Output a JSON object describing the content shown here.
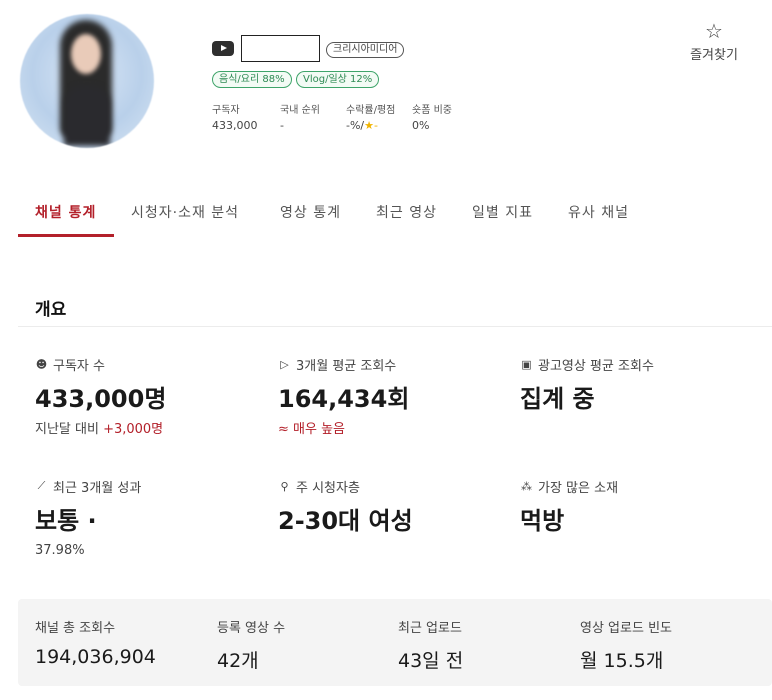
{
  "channel": {
    "mcn": "크리시아미디어",
    "categories": [
      "음식/요리 88%",
      "Vlog/일상 12%"
    ],
    "mini_stats": [
      {
        "label": "구독자",
        "value": "433,000"
      },
      {
        "label": "국내 순위",
        "value": "-"
      },
      {
        "label": "수락률/평점",
        "value": "-%/",
        "star": "★",
        "star_value": "-"
      },
      {
        "label": "숏폼 비중",
        "value": "0%"
      }
    ]
  },
  "favorite": {
    "icon": "☆",
    "label": "즐겨찾기"
  },
  "tabs": [
    "채널 통계",
    "시청자·소재 분석",
    "영상 통계",
    "최근 영상",
    "일별 지표",
    "유사 채널"
  ],
  "overview": {
    "title": "개요",
    "stats": [
      {
        "icon": "☻",
        "label": "구독자 수",
        "value": "433,000명",
        "sub_prefix": "지난달 대비 ",
        "sub_highlight": "+3,000명"
      },
      {
        "icon": "▷",
        "label": "3개월 평균 조회수",
        "value": "164,434회",
        "sub_red": "≈ 매우 높음"
      },
      {
        "icon": "▣",
        "label": "광고영상 평균 조회수",
        "value": "집계 중"
      },
      {
        "icon": "⟋",
        "label": "최근 3개월 성과",
        "value": "보통 ·",
        "sub_plain": "37.98%"
      },
      {
        "icon": "⚲",
        "label": "주 시청자층",
        "value": "2-30대 여성"
      },
      {
        "icon": "⁂",
        "label": "가장 많은 소재",
        "value": "먹방"
      }
    ]
  },
  "summary": [
    {
      "label": "채널 총 조회수",
      "value": "194,036,904"
    },
    {
      "label": "등록 영상 수",
      "value": "42개"
    },
    {
      "label": "최근 업로드",
      "value": "43일 전"
    },
    {
      "label": "영상 업로드 빈도",
      "value": "월 15.5개"
    }
  ],
  "colors": {
    "accent": "#b3202a",
    "category_green": "#2e8a54",
    "star": "#f0b400"
  }
}
